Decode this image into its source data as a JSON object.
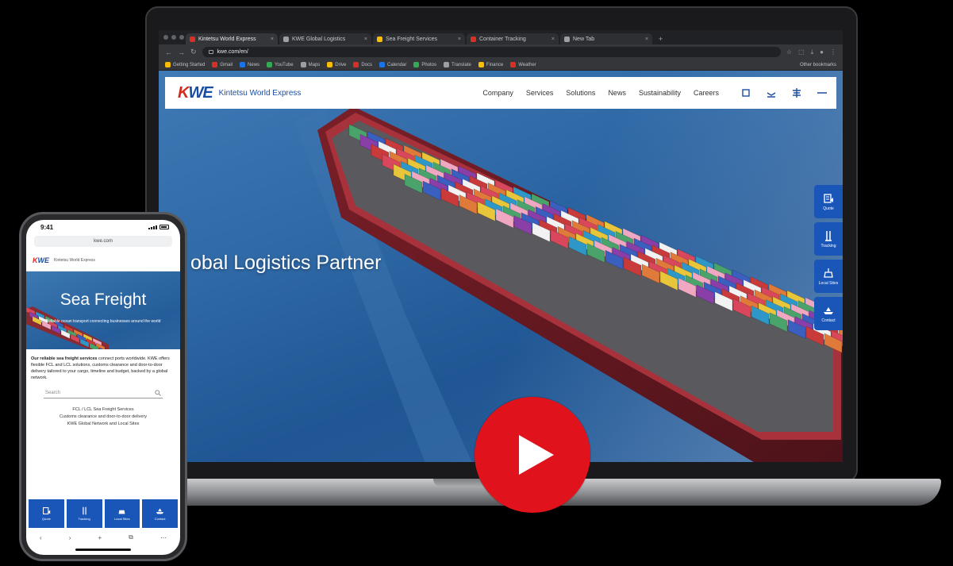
{
  "browser": {
    "tabs": [
      {
        "label": "Kintetsu World Express",
        "favicon_color": "#d93025"
      },
      {
        "label": "KWE Global Logistics",
        "favicon_color": "#9aa0a6"
      },
      {
        "label": "Sea Freight Services",
        "favicon_color": "#fbbc04"
      },
      {
        "label": "Container Tracking",
        "favicon_color": "#d93025"
      },
      {
        "label": "New Tab",
        "favicon_color": "#9aa0a6"
      }
    ],
    "new_tab_label": "+",
    "url": "kwe.com/en/",
    "bookmarks": [
      "Getting Started",
      "Gmail",
      "News",
      "YouTube",
      "Maps",
      "Drive",
      "Docs",
      "Calendar",
      "Photos",
      "Translate",
      "Finance",
      "Weather"
    ],
    "bookmarks_end": "Other bookmarks"
  },
  "site": {
    "logo": {
      "k": "K",
      "rest": "WE"
    },
    "company_name": "Kintetsu World Express",
    "nav": [
      "Company",
      "Services",
      "Solutions",
      "News",
      "Sustainability",
      "Careers"
    ],
    "hero_title": "obal Logistics Partner",
    "side_widgets": [
      "Quote",
      "Tracking",
      "Local Sites",
      "Contact"
    ]
  },
  "phone": {
    "time": "9:41",
    "url": "kwe.com",
    "logo": {
      "k": "K",
      "rest": "WE"
    },
    "company_name": "Kintetsu World Express",
    "hero_title": "Sea Freight",
    "hero_subtitle": "Reliable ocean transport connecting businesses around the world",
    "body_lead": "Our reliable sea freight services",
    "body_text": " connect ports worldwide. KWE offers flexible FCL and LCL solutions, customs clearance and door-to-door delivery tailored to your cargo, timeline and budget, backed by a global network.",
    "search_placeholder": "Search",
    "links": [
      "FCL / LCL Sea Freight Services",
      "Customs clearance and door-to-door delivery",
      "KWE Global Network and Local Sites"
    ],
    "quick_items": [
      "Quote",
      "Tracking",
      "Local Sites",
      "Contact"
    ],
    "toolbar": [
      "‹",
      "›",
      "+",
      "⧉",
      "⋯"
    ]
  },
  "colors": {
    "kwe_blue": "#1a4ea1",
    "kwe_red": "#d52b1e",
    "widget_blue": "#1a56b8",
    "play_red": "#e0121b"
  }
}
